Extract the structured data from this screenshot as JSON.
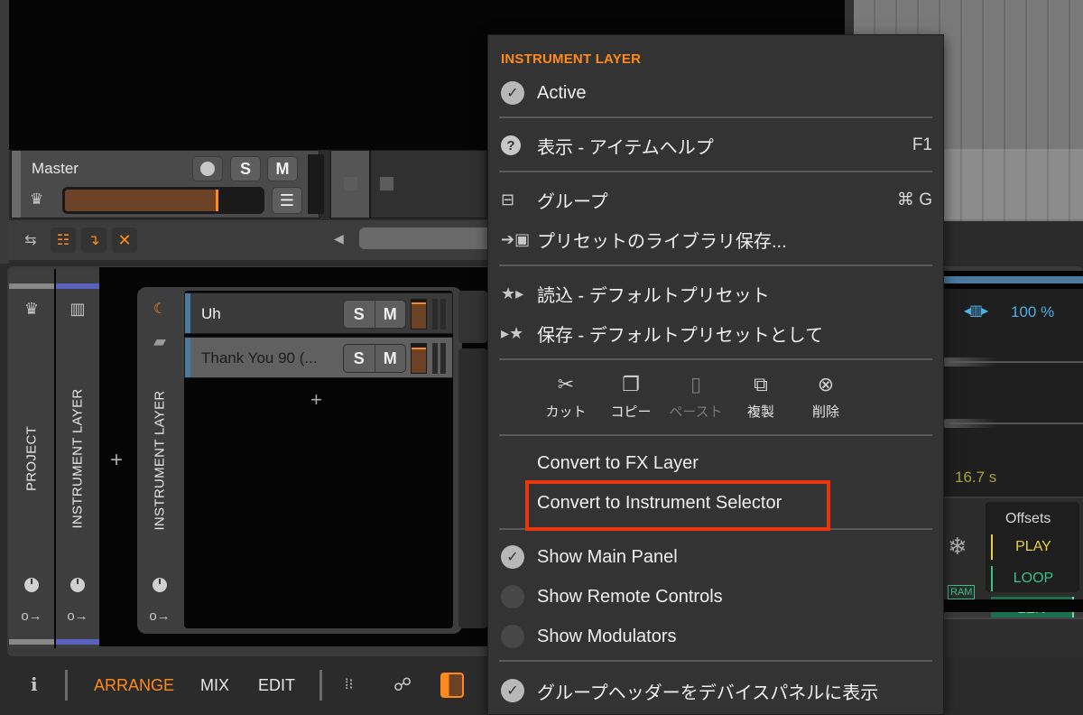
{
  "master_track": {
    "name": "Master",
    "solo_label": "S",
    "mute_label": "M",
    "volume_fraction": 0.78
  },
  "toolbar": {
    "icons": [
      "swap-icon",
      "layout-icon",
      "insert-arrow-icon",
      "close-icon",
      "scroll-left-icon"
    ]
  },
  "device_chain": {
    "columns": [
      {
        "label": "PROJECT",
        "icon": "crown-icon",
        "cap_color": "#888888"
      },
      {
        "label": "INSTRUMENT LAYER",
        "icon": "piano-icon",
        "cap_color": "#5a62c0"
      },
      {
        "label": "INSTRUMENT LAYER",
        "icon": "moon-icon",
        "cap_color": ""
      }
    ],
    "layers": [
      {
        "name": "Uh",
        "solo": "S",
        "mute": "M",
        "meter_level": 0.85
      },
      {
        "name": "Thank You 90 (...",
        "solo": "S",
        "mute": "M",
        "meter_level": 0.8
      }
    ]
  },
  "sampler": {
    "pitch_value": "100 %",
    "duration": "16.7 s",
    "offsets_title": "Offsets",
    "offsets": [
      "PLAY",
      "LOOP",
      "LEN"
    ],
    "ram_label": "RAM"
  },
  "bottom_bar": {
    "info_label": "i",
    "tabs": [
      {
        "label": "ARRANGE",
        "active": true
      },
      {
        "label": "MIX",
        "active": false
      },
      {
        "label": "EDIT",
        "active": false
      }
    ]
  },
  "context_menu": {
    "header": "INSTRUMENT LAYER",
    "active_label": "Active",
    "help_label": "表示 - アイテムヘルプ",
    "help_shortcut": "F1",
    "group_label": "グループ",
    "group_shortcut": "⌘ G",
    "save_library_label": "プリセットのライブラリ保存...",
    "load_default_label": "読込 - デフォルトプリセット",
    "save_default_label": "保存 - デフォルトプリセットとして",
    "edit_actions": [
      {
        "label": "カット",
        "icon": "scissors-icon",
        "enabled": true
      },
      {
        "label": "コピー",
        "icon": "copy-icon",
        "enabled": true
      },
      {
        "label": "ペースト",
        "icon": "paste-icon",
        "enabled": false
      },
      {
        "label": "複製",
        "icon": "duplicate-icon",
        "enabled": true
      },
      {
        "label": "削除",
        "icon": "delete-icon",
        "enabled": true
      }
    ],
    "convert_fx_label": "Convert to FX Layer",
    "convert_selector_label": "Convert to Instrument Selector",
    "show_main_panel_label": "Show Main Panel",
    "show_main_panel_checked": true,
    "show_remote_controls_label": "Show Remote Controls",
    "show_remote_controls_checked": false,
    "show_modulators_label": "Show Modulators",
    "show_modulators_checked": false,
    "show_group_header_label": "グループヘッダーをデバイスパネルに表示",
    "show_group_header_checked": true,
    "highlight_color": "#e8340f"
  },
  "colors": {
    "accent_orange": "#ff8a1a",
    "layer_blue": "#5a62c0",
    "pitch_blue": "#4ab0e8",
    "play_yellow": "#e8d040",
    "loop_green": "#3cc08a"
  }
}
